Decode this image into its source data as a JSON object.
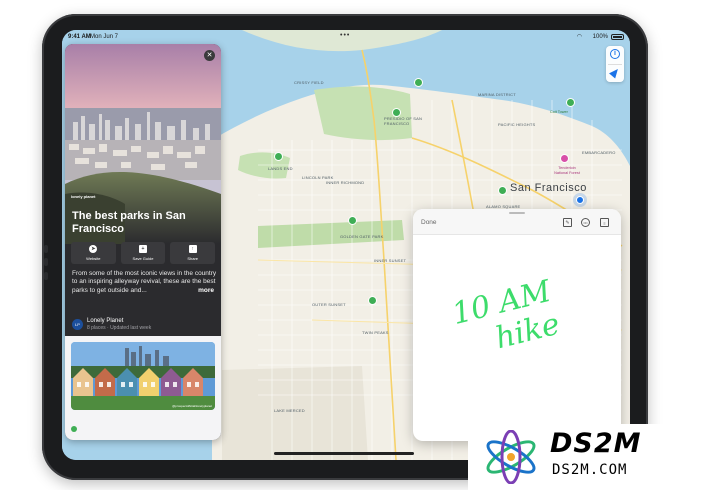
{
  "status_bar": {
    "time": "9:41 AM",
    "date": "Mon Jun 7",
    "dots": "•••",
    "battery": "100%"
  },
  "map": {
    "city": "San Francisco",
    "labels": {
      "crissy_field": "Crissy Field",
      "presidio": "Presidio of San Francisco",
      "marina": "Marina District",
      "pacific_heights": "Pacific Heights",
      "richmond": "Inner Richmond",
      "lands_end": "Lands End",
      "lincoln_park": "Lincoln Park",
      "golden_gate_park": "Golden Gate Park",
      "sunset": "Inner Sunset",
      "alamo": "Alamo Square",
      "tenderloin": "Tenderloin National Forest",
      "coit": "Coit Tower",
      "outer_sunset": "Outer Sunset",
      "twin_peaks": "Twin Peaks",
      "lake_merced": "Lake Merced",
      "embarcadero": "Embarcadero"
    }
  },
  "guide": {
    "publisher_mark": "lonely planet",
    "title": "The best parks in San Francisco",
    "actions": [
      {
        "label": "Website",
        "icon": "compass-icon"
      },
      {
        "label": "Save Guide",
        "icon": "save-icon"
      },
      {
        "label": "Share",
        "icon": "share-icon"
      }
    ],
    "description": "From some of the most iconic views in the country to an inspiring alleyway revival, these are the best parks to get outside and...",
    "more": "more",
    "author": "Lonely Planet",
    "meta": "8 places · Updated last week",
    "photo_credit": "@prospectofficial/lonelyplanet"
  },
  "note": {
    "done": "Done",
    "handwriting_line1": "10 AM",
    "handwriting_line2": "hike"
  },
  "watermark": {
    "title": "DS2M",
    "subtitle": "DS2M.COM"
  },
  "colors": {
    "park_green": "#3fae55",
    "water": "#a7d2ea",
    "land": "#f2efe6",
    "ink": "#3ddc6b"
  }
}
